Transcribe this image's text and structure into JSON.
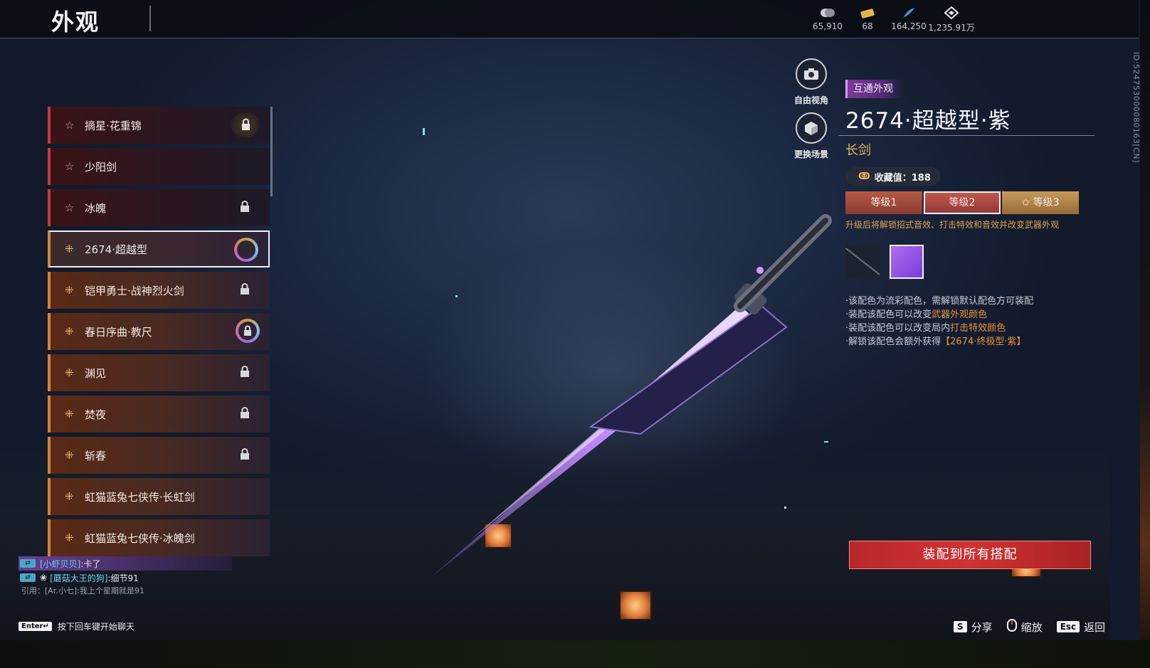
{
  "header": {
    "title": "外观",
    "currencies": [
      {
        "icon": "coin-icon",
        "value": "65,910"
      },
      {
        "icon": "ticket-icon",
        "value": "68"
      },
      {
        "icon": "feather-icon",
        "value": "164,250"
      },
      {
        "icon": "diamond-icon",
        "value": "1,235.91万"
      }
    ]
  },
  "skins": [
    {
      "name": "摘星·花重锦",
      "rarity": "red",
      "status": "lock-badge"
    },
    {
      "name": "少阳剑",
      "rarity": "red",
      "status": "none"
    },
    {
      "name": "冰魄",
      "rarity": "red",
      "status": "lock"
    },
    {
      "name": "2674·超越型",
      "rarity": "orange",
      "status": "ring",
      "selected": true
    },
    {
      "name": "铠甲勇士·战神烈火剑",
      "rarity": "orange",
      "status": "lock"
    },
    {
      "name": "春日序曲·教尺",
      "rarity": "orange",
      "status": "ring-lock"
    },
    {
      "name": "渊见",
      "rarity": "orange",
      "status": "lock"
    },
    {
      "name": "焚夜",
      "rarity": "orange",
      "status": "lock"
    },
    {
      "name": "斩春",
      "rarity": "orange",
      "status": "lock"
    },
    {
      "name": "虹猫蓝兔七侠传·长虹剑",
      "rarity": "orange",
      "status": "none"
    },
    {
      "name": "虹猫蓝兔七侠传·冰魄剑",
      "rarity": "orange",
      "status": "none"
    }
  ],
  "camera": {
    "free_view": "自由视角",
    "change_scene": "更换场景"
  },
  "detail": {
    "tag": "互通外观",
    "name": "2674·超越型·紫",
    "type": "长剑",
    "collect_label": "收藏值：188",
    "levels": [
      "等级1",
      "等级2",
      "等级3"
    ],
    "level_note": "升级后将解锁招式音效、打击特效和音效并改变武器外观",
    "notes": {
      "l1": "·该配色为流彩配色，需解锁默认配色方可装配",
      "l2a": "·装配该配色可以改变",
      "l2b": "武器外观颜色",
      "l3a": "·装配该配色可以改变局内",
      "l3b": "打击特效颜色",
      "l4a": "·解锁该配色会额外获得",
      "l4b": "【2674·终极型·紫】"
    }
  },
  "equip_button": "装配到所有搭配",
  "chat": {
    "line1_name": "[小虾贝贝]",
    "line1_msg": ":卡了",
    "line2_name": "[蘑菇大王的狗]",
    "line2_msg": ":细节91",
    "quote": "引用：[Ar.小七]:我上个星期就是91",
    "enter_key": "Enter↵",
    "hint": "按下回车键开始聊天"
  },
  "footer": {
    "share_key": "S",
    "share": "分享",
    "zoom": "缩放",
    "back_key": "Esc",
    "back": "返回"
  },
  "side_id": "ID:524753000080163[CN]",
  "colors": {
    "accent_red": "#c73a3e",
    "accent_orange": "#d6843a",
    "purple": "#a05ce8",
    "gold": "#e7b25a"
  }
}
